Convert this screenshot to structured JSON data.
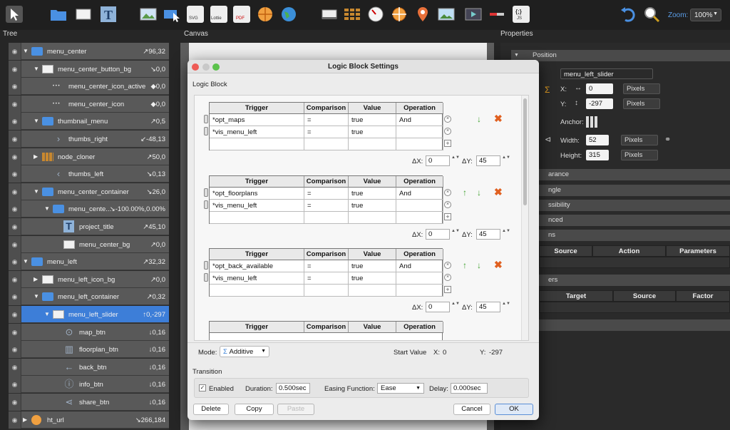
{
  "toolbar": {
    "zoom_label": "Zoom:",
    "zoom_value": "100%",
    "icons": [
      "cursor-icon",
      "folder-icon",
      "rectangle-icon",
      "text-icon",
      "image-icon",
      "hotspot-icon",
      "svg-icon",
      "lottie-icon",
      "pdf-icon",
      "sphere-icon",
      "map-icon",
      "cloner-icon",
      "grid-icon",
      "clock-icon",
      "compass-icon",
      "pin-icon",
      "photo-icon",
      "video-icon",
      "slider-icon",
      "code-icon",
      "undo-icon",
      "zoom-icon"
    ],
    "icon_labels": {
      "svg": "SVG",
      "lottie": "Lottie",
      "pdf": "PDF",
      "js": "JS",
      "code": "{;}"
    }
  },
  "panels": {
    "tree": "Tree",
    "canvas": "Canvas",
    "properties": "Properties"
  },
  "tree": {
    "items": [
      {
        "label": "menu_center",
        "value": "↗96,32"
      },
      {
        "label": "menu_center_button_bg",
        "value": "↘0,0"
      },
      {
        "label": "menu_center_icon_active",
        "value": "◆0,0"
      },
      {
        "label": "menu_center_icon",
        "value": "◆0,0"
      },
      {
        "label": "thumbnail_menu",
        "value": "↗0,5"
      },
      {
        "label": "thumbs_right",
        "value": "↙-48,13"
      },
      {
        "label": "node_cloner",
        "value": "↗50,0"
      },
      {
        "label": "thumbs_left",
        "value": "↘0,13"
      },
      {
        "label": "menu_center_container",
        "value": "↘26,0"
      },
      {
        "label": "menu_cente...",
        "value": "↘-100.00%,0.00%"
      },
      {
        "label": "project_title",
        "value": "↗45,10"
      },
      {
        "label": "menu_center_bg",
        "value": "↗0,0"
      },
      {
        "label": "menu_left",
        "value": "↗32,32"
      },
      {
        "label": "menu_left_icon_bg",
        "value": "↗0,0"
      },
      {
        "label": "menu_left_container",
        "value": "↗0,32"
      },
      {
        "label": "menu_left_slider",
        "value": "↑0,-297"
      },
      {
        "label": "map_btn",
        "value": "↓0,16"
      },
      {
        "label": "floorplan_btn",
        "value": "↓0,16"
      },
      {
        "label": "back_btn",
        "value": "↓0,16"
      },
      {
        "label": "info_btn",
        "value": "↓0,16"
      },
      {
        "label": "share_btn",
        "value": "↓0,16"
      },
      {
        "label": "ht_url",
        "value": "↘266,184"
      }
    ]
  },
  "properties": {
    "position_header": "Position",
    "name_value": "menu_left_slider",
    "x_label": "X:",
    "x_value": "0",
    "y_label": "Y:",
    "y_value": "-297",
    "unit": "Pixels",
    "anchor_label": "Anchor:",
    "width_label": "Width:",
    "width_value": "52",
    "height_label": "Height:",
    "height_value": "315",
    "section_headers": [
      "arance",
      "ngle",
      "ssibility",
      "nced",
      "ns"
    ],
    "actions_cols": [
      "Source",
      "Action",
      "Parameters"
    ],
    "section_headers2": [
      "ers"
    ],
    "modifiers_cols": [
      "Target",
      "Source",
      "Factor"
    ]
  },
  "dialog": {
    "title": "Logic Block Settings",
    "section_label": "Logic Block",
    "columns": [
      "Trigger",
      "Comparison",
      "Value",
      "Operation"
    ],
    "blocks": [
      {
        "rows": [
          [
            "*opt_maps",
            "=",
            "true",
            "And"
          ],
          [
            "*vis_menu_left",
            "=",
            "true",
            ""
          ]
        ],
        "dx": "0",
        "dy": "45"
      },
      {
        "rows": [
          [
            "*opt_floorplans",
            "=",
            "true",
            "And"
          ],
          [
            "*vis_menu_left",
            "=",
            "true",
            ""
          ]
        ],
        "dx": "0",
        "dy": "45"
      },
      {
        "rows": [
          [
            "*opt_back_available",
            "=",
            "true",
            "And"
          ],
          [
            "*vis_menu_left",
            "=",
            "true",
            ""
          ]
        ],
        "dx": "0",
        "dy": "45"
      }
    ],
    "dx_label": "ΔX:",
    "dy_label": "ΔY:",
    "mode_label": "Mode:",
    "mode_value": "Additive",
    "start_value_label": "Start Value",
    "start_x_label": "X:",
    "start_x_value": "0",
    "start_y_label": "Y:",
    "start_y_value": "-297",
    "transition_label": "Transition",
    "enabled_label": "Enabled",
    "duration_label": "Duration:",
    "duration_value": "0.500sec",
    "easing_label": "Easing Function:",
    "easing_value": "Ease",
    "delay_label": "Delay:",
    "delay_value": "0.000sec",
    "buttons": {
      "delete": "Delete",
      "copy": "Copy",
      "paste": "Paste",
      "cancel": "Cancel",
      "ok": "OK"
    }
  },
  "colors": {
    "accent": "#3d7ed8",
    "folder": "#4a90e2",
    "add_green": "#3fa12e",
    "delete_orange": "#e06020"
  }
}
